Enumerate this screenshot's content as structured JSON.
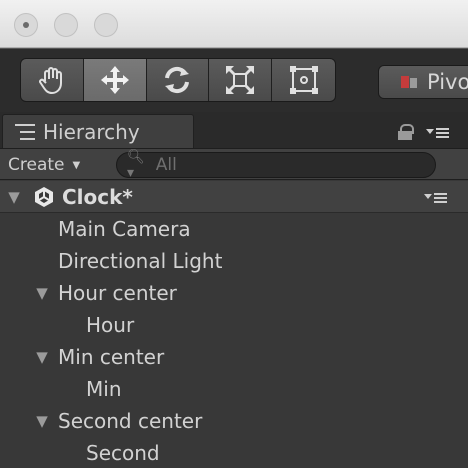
{
  "window": {
    "buttons": [
      "close",
      "minimize",
      "zoom"
    ]
  },
  "toolbar": {
    "tools": [
      {
        "name": "hand-tool",
        "icon": "hand-icon",
        "active": false
      },
      {
        "name": "move-tool",
        "icon": "move-arrows-icon",
        "active": true
      },
      {
        "name": "rotate-tool",
        "icon": "rotate-icon",
        "active": false
      },
      {
        "name": "scale-tool",
        "icon": "scale-icon",
        "active": false
      },
      {
        "name": "rect-tool",
        "icon": "rect-transform-icon",
        "active": false
      }
    ],
    "pivot_label": "Pivo"
  },
  "hierarchy": {
    "tab_label": "Hierarchy",
    "create_label": "Create",
    "search_placeholder": "All",
    "scene": {
      "name": "Clock*"
    },
    "items": [
      {
        "label": "Main Camera",
        "depth": 1,
        "expandable": false
      },
      {
        "label": "Directional Light",
        "depth": 1,
        "expandable": false
      },
      {
        "label": "Hour center",
        "depth": 1,
        "expandable": true
      },
      {
        "label": "Hour",
        "depth": 2,
        "expandable": false
      },
      {
        "label": "Min center",
        "depth": 1,
        "expandable": true
      },
      {
        "label": "Min",
        "depth": 2,
        "expandable": false
      },
      {
        "label": "Second center",
        "depth": 1,
        "expandable": true
      },
      {
        "label": "Second",
        "depth": 2,
        "expandable": false
      }
    ]
  },
  "colors": {
    "panel_bg": "#383838",
    "toolbar_bg": "#2c2c2c",
    "text": "#d2d2d2",
    "pivot_accent": "#c43c3c"
  }
}
